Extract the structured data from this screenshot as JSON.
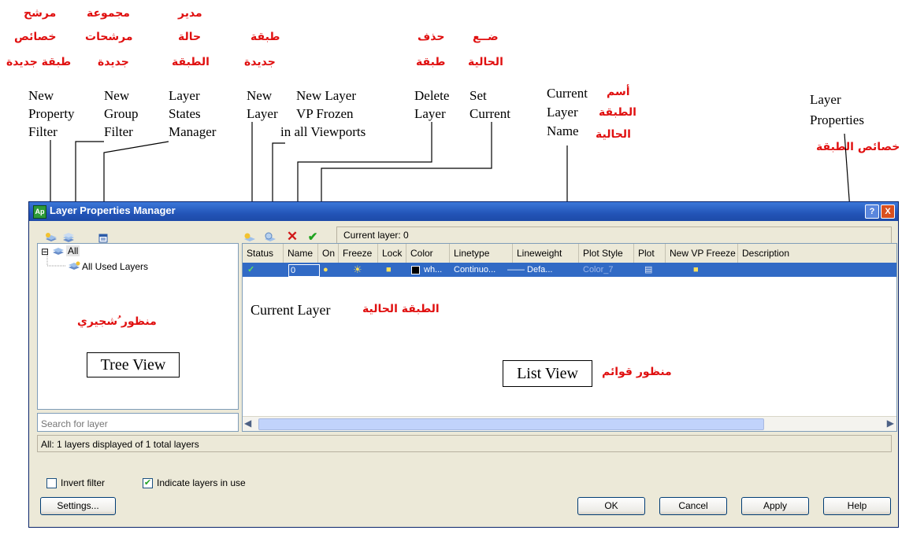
{
  "annotations": {
    "new_property_filter": {
      "arabic": [
        "مرشح",
        "خصائص",
        "طبقة جديدة"
      ],
      "english": [
        "New",
        "Property",
        "Filter"
      ]
    },
    "new_group_filter": {
      "arabic": [
        "مجموعة",
        "مرشحات",
        "جديدة"
      ],
      "english": [
        "New",
        "Group",
        "Filter"
      ]
    },
    "layer_states_manager": {
      "arabic": [
        "مدير",
        "حالة",
        "الطبقة"
      ],
      "english": [
        "Layer",
        "States",
        "Manager"
      ]
    },
    "new_layer": {
      "arabic": [
        "طبقة",
        "جديدة"
      ],
      "english": [
        "New",
        "Layer"
      ]
    },
    "new_layer_vp_frozen": {
      "english": [
        "New Layer",
        "VP Frozen",
        "in all Viewports"
      ]
    },
    "delete_layer": {
      "arabic": [
        "حذف",
        "طبقة"
      ],
      "english": [
        "Delete",
        "Layer"
      ]
    },
    "set_current": {
      "arabic": [
        "ضــع",
        "الحالية"
      ],
      "english": [
        "Set",
        "Current"
      ]
    },
    "current_layer_name": {
      "arabic": [
        "أسم",
        "الطبقة",
        "الحالية"
      ],
      "english": [
        "Current",
        "Layer",
        "Name"
      ]
    },
    "layer_properties": {
      "arabic": [
        "خصائص الطبقة"
      ],
      "english": [
        "Layer",
        "Properties"
      ]
    },
    "current_layer_callout": {
      "english": "Current Layer",
      "arabic": "الطبقة الحالية"
    },
    "tree_view_callout": {
      "english": "Tree View",
      "arabic": "منظور ُشجيري"
    },
    "list_view_callout": {
      "english": "List View",
      "arabic": "منظور قوائم"
    }
  },
  "window": {
    "title": "Layer Properties Manager",
    "app_icon": "Ap",
    "help_button": "?",
    "close_button": "X"
  },
  "toolbar": {
    "icons": [
      "new-property-filter-icon",
      "new-group-filter-icon",
      "layer-states-manager-icon",
      "new-layer-icon",
      "new-layer-vp-frozen-icon",
      "delete-layer-icon",
      "set-current-icon"
    ],
    "current_layer_label": "Current layer: 0"
  },
  "tree": {
    "root_label": "All",
    "child_label": "All Used Layers",
    "expand_symbol": "⊟"
  },
  "search": {
    "placeholder": "Search for layer"
  },
  "list": {
    "columns": [
      "Status",
      "Name",
      "On",
      "Freeze",
      "Lock",
      "Color",
      "Linetype",
      "Lineweight",
      "Plot Style",
      "Plot",
      "New VP Freeze",
      "Description"
    ],
    "row": {
      "status": "✓",
      "name": "0",
      "color": "wh...",
      "linetype": "Continuo...",
      "lineweight": "—— Defa...",
      "plot_style": "Color_7"
    }
  },
  "status_text": "All: 1 layers displayed of 1 total layers",
  "options": {
    "invert_filter": {
      "label": "Invert filter",
      "checked": false
    },
    "indicate_layers": {
      "label": "Indicate layers in use",
      "checked": true
    }
  },
  "buttons": {
    "settings": "Settings...",
    "ok": "OK",
    "cancel": "Cancel",
    "apply": "Apply",
    "help": "Help"
  },
  "colors": {
    "title_bar": "#2355b8",
    "annotation_red": "#e01010",
    "selection": "#316ac5",
    "dialog_bg": "#ece9d8"
  }
}
